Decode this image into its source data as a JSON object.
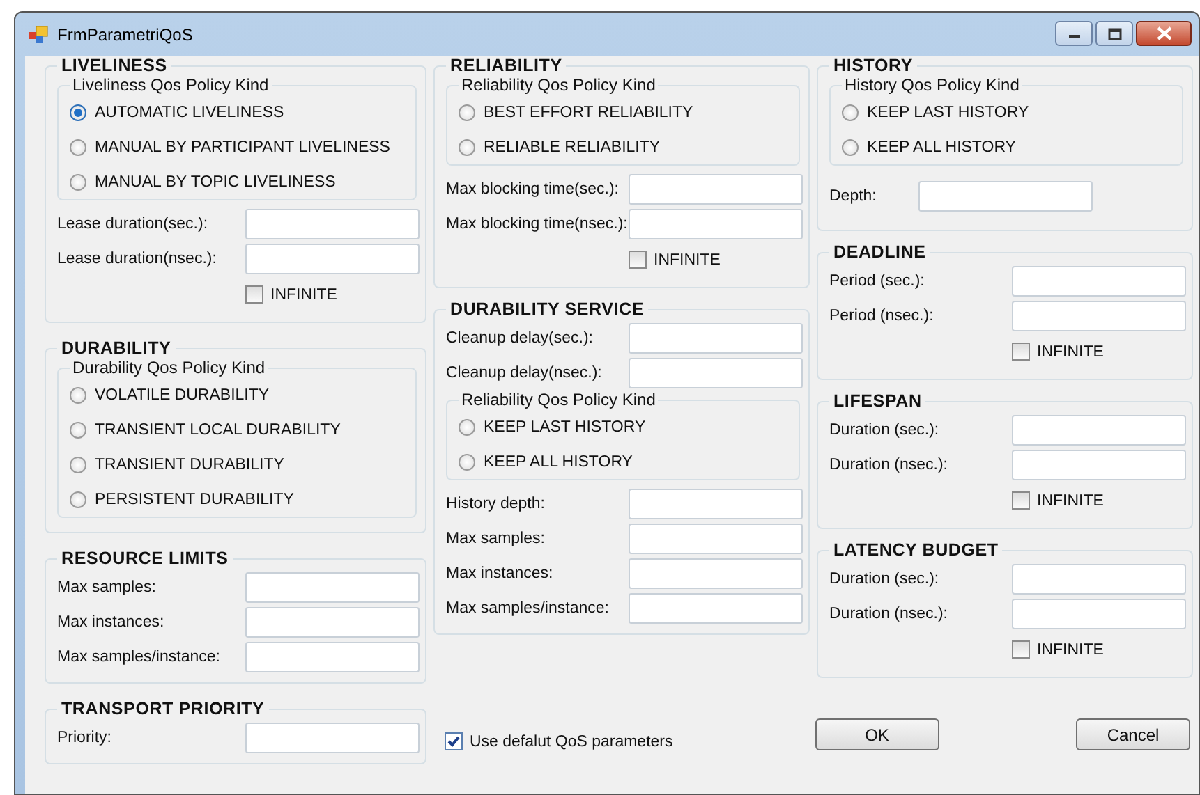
{
  "window": {
    "title": "FrmParametriQoS"
  },
  "columns": [
    [
      {
        "title": "LIVELINESS",
        "items": [
          {
            "kind": "policy",
            "title": "Liveliness Qos Policy Kind",
            "options": [
              {
                "label": "AUTOMATIC LIVELINESS",
                "selected": true
              },
              {
                "label": "MANUAL BY PARTICIPANT LIVELINESS",
                "selected": false
              },
              {
                "label": "MANUAL BY TOPIC LIVELINESS",
                "selected": false
              }
            ]
          },
          {
            "kind": "field",
            "label": "Lease  duration(sec.):"
          },
          {
            "kind": "field",
            "label": "Lease  duration(nsec.):"
          },
          {
            "kind": "checkbox",
            "label": "INFINITE",
            "checked": false
          }
        ]
      },
      {
        "title": "DURABILITY",
        "items": [
          {
            "kind": "policy",
            "title": "Durability Qos Policy Kind",
            "options": [
              {
                "label": "VOLATILE DURABILITY",
                "selected": false
              },
              {
                "label": "TRANSIENT LOCAL DURABILITY",
                "selected": false
              },
              {
                "label": "TRANSIENT DURABILITY",
                "selected": false
              },
              {
                "label": "PERSISTENT DURABILITY",
                "selected": false
              }
            ]
          }
        ]
      },
      {
        "title": "RESOURCE LIMITS",
        "items": [
          {
            "kind": "field",
            "label": "Max samples:"
          },
          {
            "kind": "field",
            "label": "Max instances:"
          },
          {
            "kind": "field",
            "label": "Max samples/instance:"
          }
        ]
      },
      {
        "title": "TRANSPORT PRIORITY",
        "items": [
          {
            "kind": "field",
            "label": "Priority:"
          }
        ]
      }
    ],
    [
      {
        "title": "RELIABILITY",
        "items": [
          {
            "kind": "policy",
            "title": "Reliability Qos Policy Kind",
            "options": [
              {
                "label": "BEST EFFORT RELIABILITY",
                "selected": false
              },
              {
                "label": "RELIABLE RELIABILITY",
                "selected": false
              }
            ]
          },
          {
            "kind": "field",
            "label": "Max blocking time(sec.):"
          },
          {
            "kind": "field",
            "label": "Max blocking time(nsec.):"
          },
          {
            "kind": "checkbox",
            "label": "INFINITE",
            "checked": false
          }
        ]
      },
      {
        "title": "DURABILITY SERVICE",
        "items": [
          {
            "kind": "field",
            "label": "Cleanup delay(sec.):"
          },
          {
            "kind": "field",
            "label": "Cleanup delay(nsec.):"
          },
          {
            "kind": "policy",
            "title": "Reliability Qos Policy Kind",
            "options": [
              {
                "label": "KEEP LAST HISTORY",
                "selected": false
              },
              {
                "label": "KEEP ALL HISTORY",
                "selected": false
              }
            ]
          },
          {
            "kind": "field",
            "label": "History depth:"
          },
          {
            "kind": "field",
            "label": "Max samples:"
          },
          {
            "kind": "field",
            "label": "Max instances:"
          },
          {
            "kind": "field",
            "label": "Max samples/instance:"
          }
        ]
      }
    ],
    [
      {
        "title": "HISTORY",
        "items": [
          {
            "kind": "policy",
            "title": "History Qos Policy Kind",
            "options": [
              {
                "label": "KEEP LAST HISTORY",
                "selected": false
              },
              {
                "label": "KEEP ALL HISTORY",
                "selected": false
              }
            ]
          },
          {
            "kind": "short-field",
            "label": "Depth:"
          }
        ]
      },
      {
        "title": "DEADLINE",
        "items": [
          {
            "kind": "field",
            "label": "Period (sec.):"
          },
          {
            "kind": "field",
            "label": "Period (nsec.):"
          },
          {
            "kind": "checkbox",
            "label": "INFINITE",
            "checked": false
          }
        ]
      },
      {
        "title": "LIFESPAN",
        "items": [
          {
            "kind": "field",
            "label": "Duration (sec.):"
          },
          {
            "kind": "field",
            "label": "Duration (nsec.):"
          },
          {
            "kind": "checkbox",
            "label": "INFINITE",
            "checked": false
          }
        ]
      },
      {
        "title": "LATENCY BUDGET",
        "items": [
          {
            "kind": "field",
            "label": "Duration (sec.):"
          },
          {
            "kind": "field",
            "label": "Duration (nsec.):"
          },
          {
            "kind": "checkbox",
            "label": "INFINITE",
            "checked": false
          }
        ]
      }
    ]
  ],
  "footer": {
    "use_default": {
      "label": "Use defalut QoS parameters",
      "checked": true
    },
    "buttons": [
      "OK",
      "Cancel"
    ]
  }
}
